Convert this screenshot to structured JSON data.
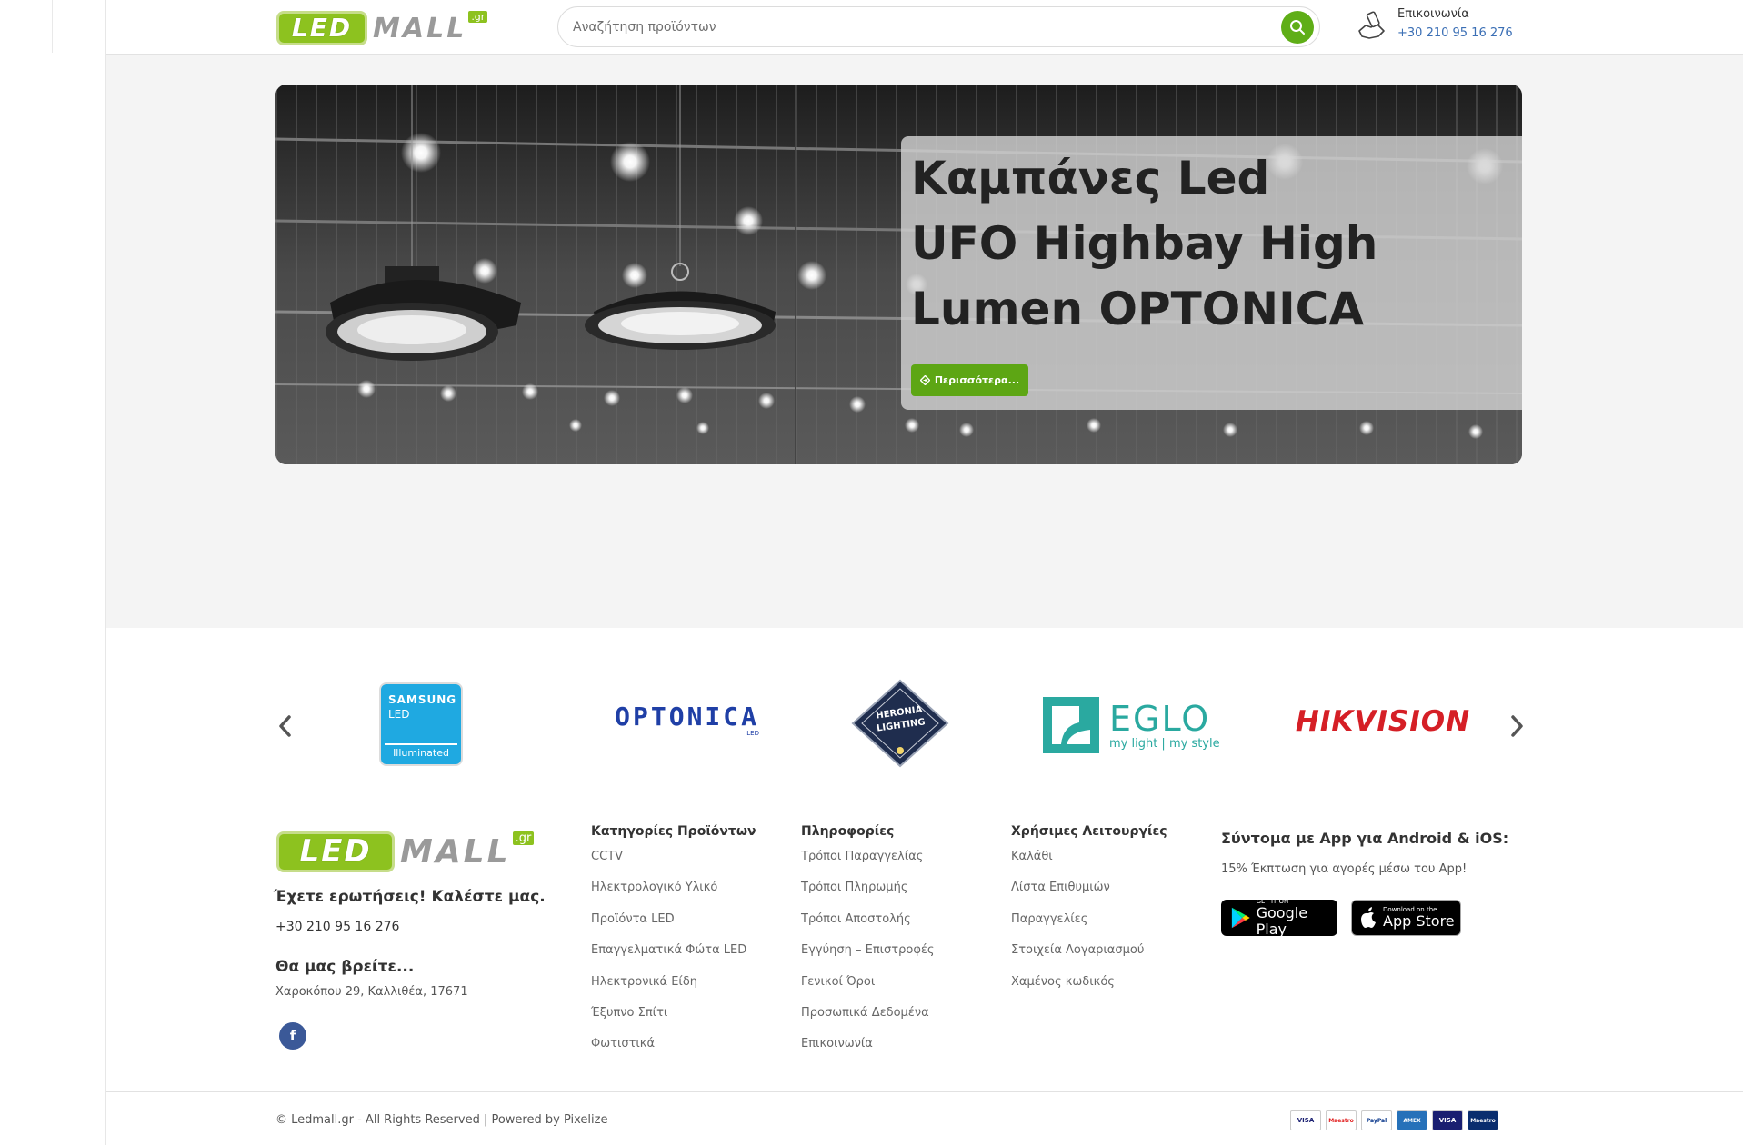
{
  "header": {
    "logo": {
      "led": "LED",
      "mall": "MALL",
      "gr": ".gr"
    },
    "search_placeholder": "Αναζήτηση προϊόντων",
    "contact": {
      "label": "Επικοινωνία",
      "phone": "+30 210 95 16 276"
    }
  },
  "hero": {
    "title_lines": [
      "Καμπάνες Led",
      "UFO Highbay High",
      "Lumen OPTONICA"
    ],
    "button_label": "Περισσότερα..."
  },
  "brands": {
    "items": [
      {
        "name": "samsung-led",
        "line1": "SAMSUNG",
        "line2": "LED",
        "line3": "Illuminated"
      },
      {
        "name": "optonica",
        "text": "OPTONICA",
        "sub": "LED"
      },
      {
        "name": "heronia",
        "line1": "HERONIA",
        "line2": "LIGHTING"
      },
      {
        "name": "eglo",
        "text": "EGLO",
        "sub": "my light | my style"
      },
      {
        "name": "hikvision",
        "text": "HIKVISION"
      }
    ]
  },
  "footer": {
    "logo": {
      "led": "LED",
      "mall": "MALL",
      "gr": ".gr"
    },
    "question": "Έχετε ερωτήσεις! Καλέστε μας.",
    "phone": "+30 210 95 16 276",
    "find_title": "Θα μας βρείτε...",
    "address": "Χαροκόπου 29, Καλλιθέα, 17671",
    "facebook": "f",
    "columns": [
      {
        "title": "Κατηγορίες Προϊόντων",
        "links": [
          "CCTV",
          "Ηλεκτρολογικό Υλικό",
          "Προϊόντα LED",
          "Επαγγελματικά Φώτα LED",
          "Ηλεκτρονικά Είδη",
          "Έξυπνο Σπίτι",
          "Φωτιστικά"
        ]
      },
      {
        "title": "Πληροφορίες",
        "links": [
          "Τρόποι Παραγγελίας",
          "Τρόποι Πληρωμής",
          "Τρόποι Αποστολής",
          "Εγγύηση – Επιστροφές",
          "Γενικοί Όροι",
          "Προσωπικά Δεδομένα",
          "Επικοινωνία"
        ]
      },
      {
        "title": "Χρήσιμες Λειτουργίες",
        "links": [
          "Καλάθι",
          "Λίστα Επιθυμιών",
          "Παραγγελίες",
          "Στοιχεία Λογαριασμού",
          "Χαμένος κωδικός"
        ]
      }
    ],
    "app": {
      "title": "Σύντομα με App για Android & iOS:",
      "subtitle": "15% Έκπτωση για αγορές μέσω του App!",
      "google": {
        "small": "GET IT ON",
        "big": "Google Play"
      },
      "apple": {
        "small": "Download on the",
        "big": "App Store"
      }
    }
  },
  "bottom": {
    "copyright": "© Ledmall.gr - All Rights Reserved | Powered by Pixelize",
    "cards": [
      "VISA",
      "Maestro",
      "PayPal",
      "AMEX",
      "VISA",
      "Maestro"
    ]
  },
  "colors": {
    "brand_green": "#8dc21f",
    "button_green": "#5da614",
    "link_blue": "#3b6fb5"
  }
}
